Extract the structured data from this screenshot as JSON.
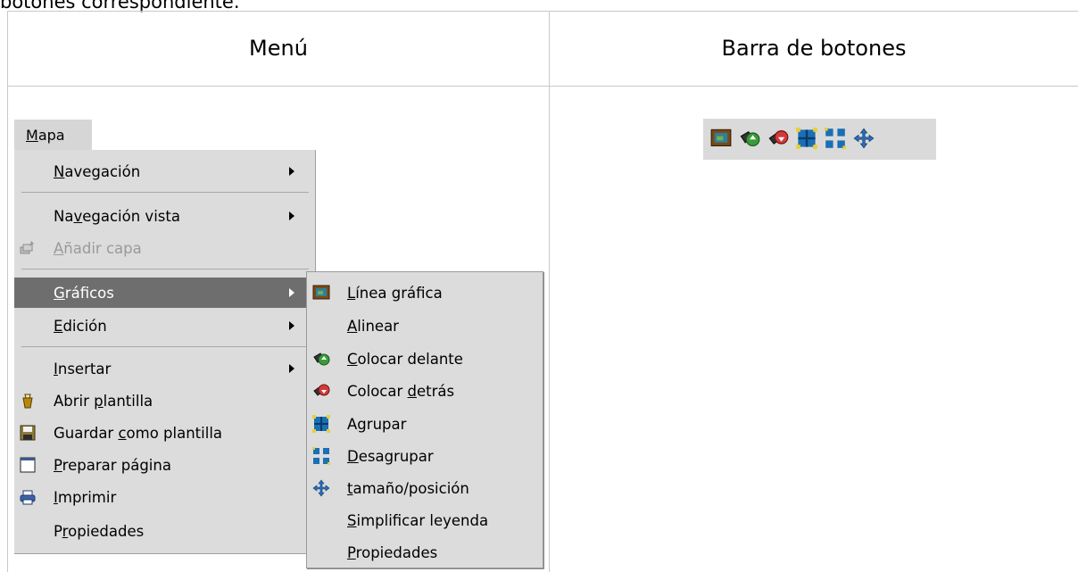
{
  "top_text": "botones correspondiente.",
  "table": {
    "col1_header": "Menú",
    "col2_header": "Barra de botones"
  },
  "menubar": {
    "title_u": "M",
    "title_rest": "apa"
  },
  "menu": {
    "navegacion": {
      "u": "N",
      "rest": "avegación"
    },
    "navegacion_vista": {
      "pre": "Na",
      "u": "v",
      "rest": "egación vista"
    },
    "anadir_capa": {
      "u": "A",
      "rest": "ñadir capa"
    },
    "graficos": {
      "u": "G",
      "rest": "ráficos"
    },
    "edicion": {
      "u": "E",
      "rest": "dición"
    },
    "insertar": {
      "u": "I",
      "rest": "nsertar"
    },
    "abrir_plantilla": {
      "pre": "Abrir ",
      "u": "p",
      "rest": "lantilla"
    },
    "guardar_plantilla": {
      "pre": "Guardar ",
      "u": "c",
      "rest": "omo plantilla"
    },
    "preparar_pagina": {
      "u": "P",
      "rest": "reparar página"
    },
    "imprimir": {
      "u": "I",
      "rest": "mprimir"
    },
    "propiedades": {
      "pre": "P",
      "u": "r",
      "rest": "opiedades"
    }
  },
  "submenu": {
    "linea_grafica": {
      "u": "L",
      "rest": "ínea gráfica"
    },
    "alinear": {
      "u": "A",
      "rest": "linear"
    },
    "colocar_delante": {
      "u": "C",
      "rest": "olocar delante"
    },
    "colocar_detras": {
      "pre": "Colocar ",
      "u": "d",
      "rest": "etrás"
    },
    "agrupar": {
      "pre": "A",
      "u": "g",
      "rest": "rupar"
    },
    "desagrupar": {
      "u": "D",
      "rest": "esagrupar"
    },
    "tamano_posicion": {
      "u": "t",
      "rest": "amaño/posición"
    },
    "simplificar_leyenda": {
      "u": "S",
      "rest": "implificar leyenda"
    },
    "propiedades": {
      "u": "P",
      "rest": "ropiedades"
    }
  },
  "toolbar_icons": [
    "line-graphic-icon",
    "bring-front-icon",
    "send-back-icon",
    "group-icon",
    "ungroup-icon",
    "move-resize-icon"
  ]
}
